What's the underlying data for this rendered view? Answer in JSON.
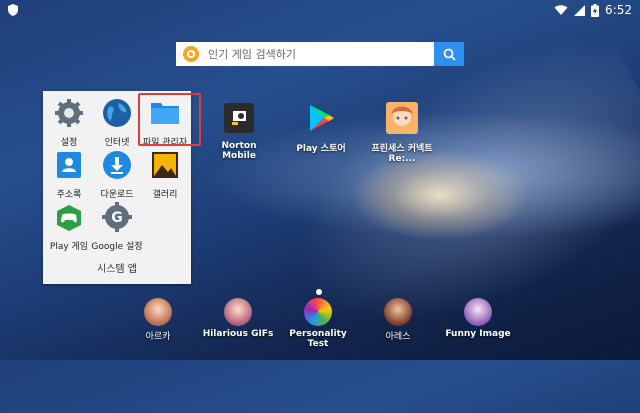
{
  "status_bar": {
    "time": "6:52"
  },
  "search": {
    "placeholder": "인기 게임 검색하기"
  },
  "folder": {
    "title": "시스템 앱",
    "apps": [
      {
        "label": "설정"
      },
      {
        "label": "인터넷"
      },
      {
        "label": "파일 관리자"
      },
      {
        "label": "주소록"
      },
      {
        "label": "다운로드"
      },
      {
        "label": "갤러리"
      },
      {
        "label": "Play 게임"
      },
      {
        "label": "Google 설정"
      }
    ]
  },
  "desktop_apps": [
    {
      "label": "Norton Mobile"
    },
    {
      "label": "Play 스토어"
    },
    {
      "label": "프린세스 커넥트 Re:..."
    }
  ],
  "dock": [
    {
      "label": "아르카"
    },
    {
      "label": "Hilarious GIFs"
    },
    {
      "label": "Personality Test"
    },
    {
      "label": "아레스"
    },
    {
      "label": "Funny Image"
    }
  ],
  "colors": {
    "highlight": "#e53a3a",
    "search_button": "#2f8ff0",
    "folder_bg": "#f2f2f2"
  }
}
